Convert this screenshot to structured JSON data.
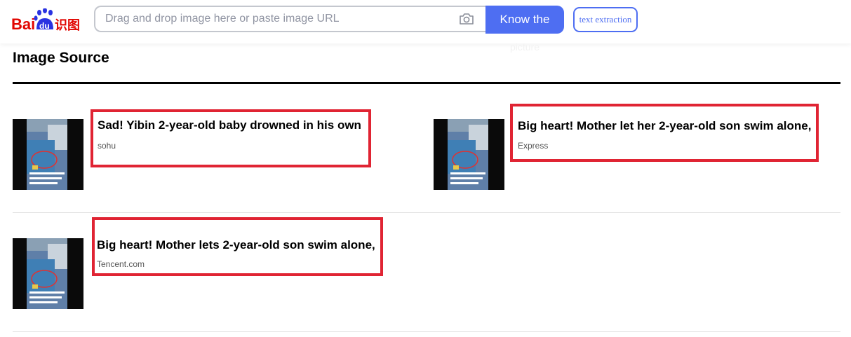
{
  "header": {
    "logo": {
      "brand_text": "Bai",
      "paw_text": "du",
      "product_text": "识图"
    },
    "search": {
      "placeholder": "Drag and drop image here or paste image URL",
      "value": ""
    },
    "camera_icon": "camera-icon",
    "know_button": {
      "label": "Know the",
      "label_overflow": "picture"
    },
    "text_extraction_button": {
      "label": "text extraction"
    }
  },
  "main": {
    "section_title": "Image Source",
    "results": [
      {
        "title": "Sad! Yibin 2-year-old baby drowned in his own",
        "source": "sohu"
      },
      {
        "title": "Big heart! Mother let her 2-year-old son swim alone,",
        "source": "Express"
      },
      {
        "title": "Big heart! Mother lets 2-year-old son swim alone,",
        "source": "Tencent.com"
      }
    ]
  },
  "colors": {
    "brand_blue": "#4e6ef2",
    "logo_red": "#e10601",
    "highlight_red": "#e02433"
  }
}
